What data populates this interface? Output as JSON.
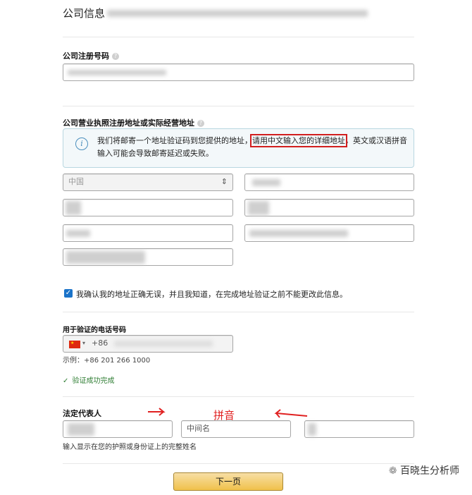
{
  "header": {
    "title": "公司信息"
  },
  "company_reg": {
    "label": "公司注册号码",
    "help_icon": "question-circle-icon"
  },
  "address": {
    "label": "公司营业执照注册地址或实际经营地址",
    "help_icon": "question-circle-icon",
    "info_icon": "info-circle-icon",
    "info_text_before": "我们将邮寄一个地址验证码到您提供的地址，",
    "info_text_highlight": "请用中文输入您的详细地址",
    "info_text_after": "，英文或汉语拼音输入可能会导致邮寄延迟或失败。",
    "country_select": "中国",
    "select_arrow": "⇕"
  },
  "confirm": {
    "checked": true,
    "text": "我确认我的地址正确无误，并且我知道，在完成地址验证之前不能更改此信息。"
  },
  "phone": {
    "label": "用于验证的电话号码",
    "prefix": "+86",
    "example": "示例：+86 201 266 1000",
    "success": "验证成功完成"
  },
  "legal_rep": {
    "label": "法定代表人",
    "middle_placeholder": "中间名",
    "hint": "输入显示在您的护照或身份证上的完整姓名",
    "annotation": "拼音"
  },
  "next_button": "下一页",
  "watermark": "百晓生分析师"
}
